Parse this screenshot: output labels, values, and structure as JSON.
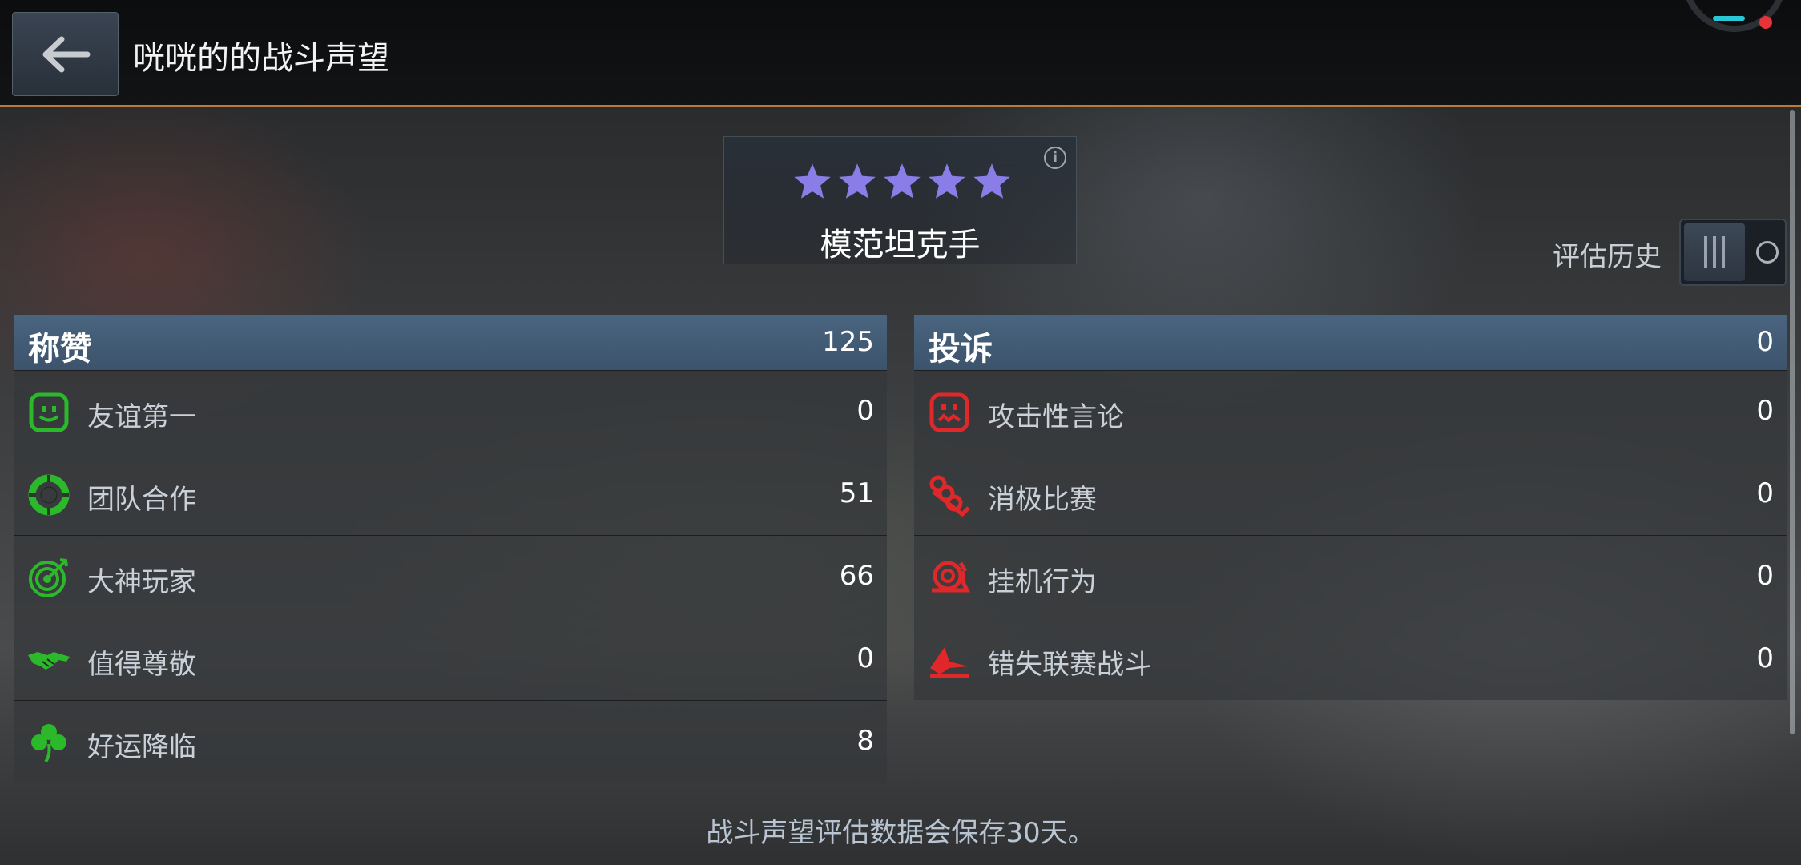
{
  "header": {
    "title": "咣咣的的战斗声望"
  },
  "rating": {
    "stars": 5,
    "max_stars": 5,
    "star_color": "#8a7de8",
    "title": "模范坦克手"
  },
  "history": {
    "label": "评估历史",
    "toggle_on": false
  },
  "praise": {
    "title": "称赞",
    "total": "125",
    "items": [
      {
        "label": "友谊第一",
        "count": "0",
        "icon": "smile-face-icon"
      },
      {
        "label": "团队合作",
        "count": "51",
        "icon": "lifebuoy-icon"
      },
      {
        "label": "大神玩家",
        "count": "66",
        "icon": "target-icon"
      },
      {
        "label": "值得尊敬",
        "count": "0",
        "icon": "handshake-icon"
      },
      {
        "label": "好运降临",
        "count": "8",
        "icon": "clover-icon"
      }
    ],
    "color": "#2bb82b"
  },
  "complaints": {
    "title": "投诉",
    "total": "0",
    "items": [
      {
        "label": "攻击性言论",
        "count": "0",
        "icon": "angry-face-icon"
      },
      {
        "label": "消极比赛",
        "count": "0",
        "icon": "brass-knuckles-icon"
      },
      {
        "label": "挂机行为",
        "count": "0",
        "icon": "snail-icon"
      },
      {
        "label": "错失联赛战斗",
        "count": "0",
        "icon": "missed-plane-icon"
      }
    ],
    "color": "#e0282a"
  },
  "footer": {
    "note": "战斗声望评估数据会保存30天。"
  }
}
